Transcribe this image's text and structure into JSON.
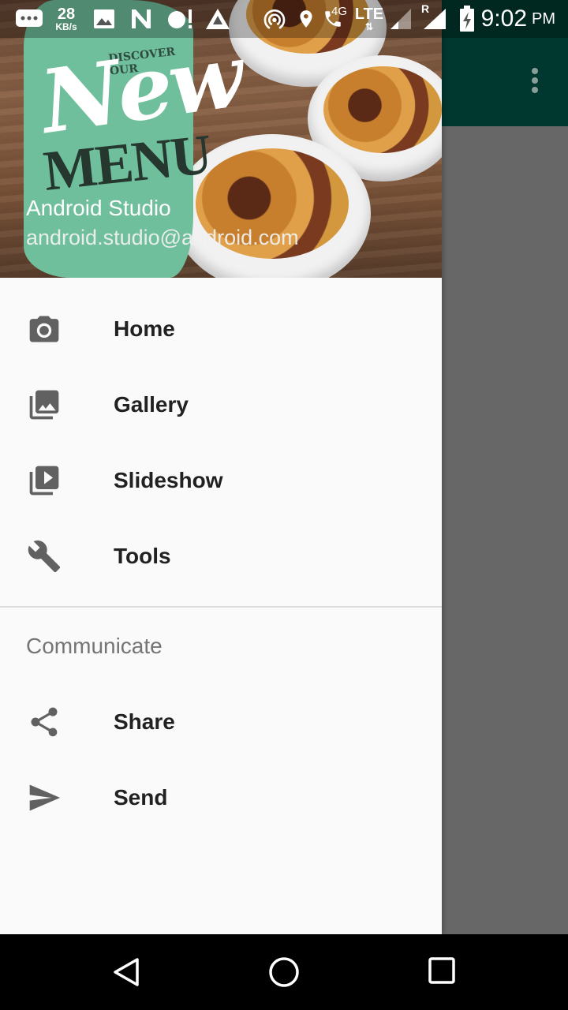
{
  "status_bar": {
    "net_speed_value": "28",
    "net_speed_unit": "KB/s",
    "network_4g": "4G",
    "network_lte": "LTE",
    "roaming": "R",
    "time": "9:02",
    "ampm": "PM",
    "icons": [
      "messages-icon",
      "image-icon",
      "n-app-icon",
      "notification-alert-icon",
      "arrow-app-icon",
      "hotspot-icon",
      "location-icon",
      "call-icon",
      "signal-icon",
      "battery-charging-icon"
    ]
  },
  "drawer": {
    "header": {
      "banner_small": "DISCOVER OUR",
      "banner_new": "New",
      "banner_menu": "MENU",
      "name": "Android Studio",
      "email": "android.studio@android.com"
    },
    "items": [
      {
        "label": "Home",
        "icon": "camera-icon"
      },
      {
        "label": "Gallery",
        "icon": "gallery-icon"
      },
      {
        "label": "Slideshow",
        "icon": "slideshow-icon"
      },
      {
        "label": "Tools",
        "icon": "wrench-icon"
      }
    ],
    "section": {
      "title": "Communicate",
      "items": [
        {
          "label": "Share",
          "icon": "share-icon"
        },
        {
          "label": "Send",
          "icon": "send-icon"
        }
      ]
    }
  },
  "colors": {
    "toolbar": "#00382f",
    "scrim": "#676767",
    "drawer_bg": "#fafafa",
    "icon": "#616161",
    "label": "#212121",
    "section": "#757575"
  },
  "nav_bar": {
    "icons": [
      "back-icon",
      "home-icon",
      "recents-icon"
    ]
  }
}
